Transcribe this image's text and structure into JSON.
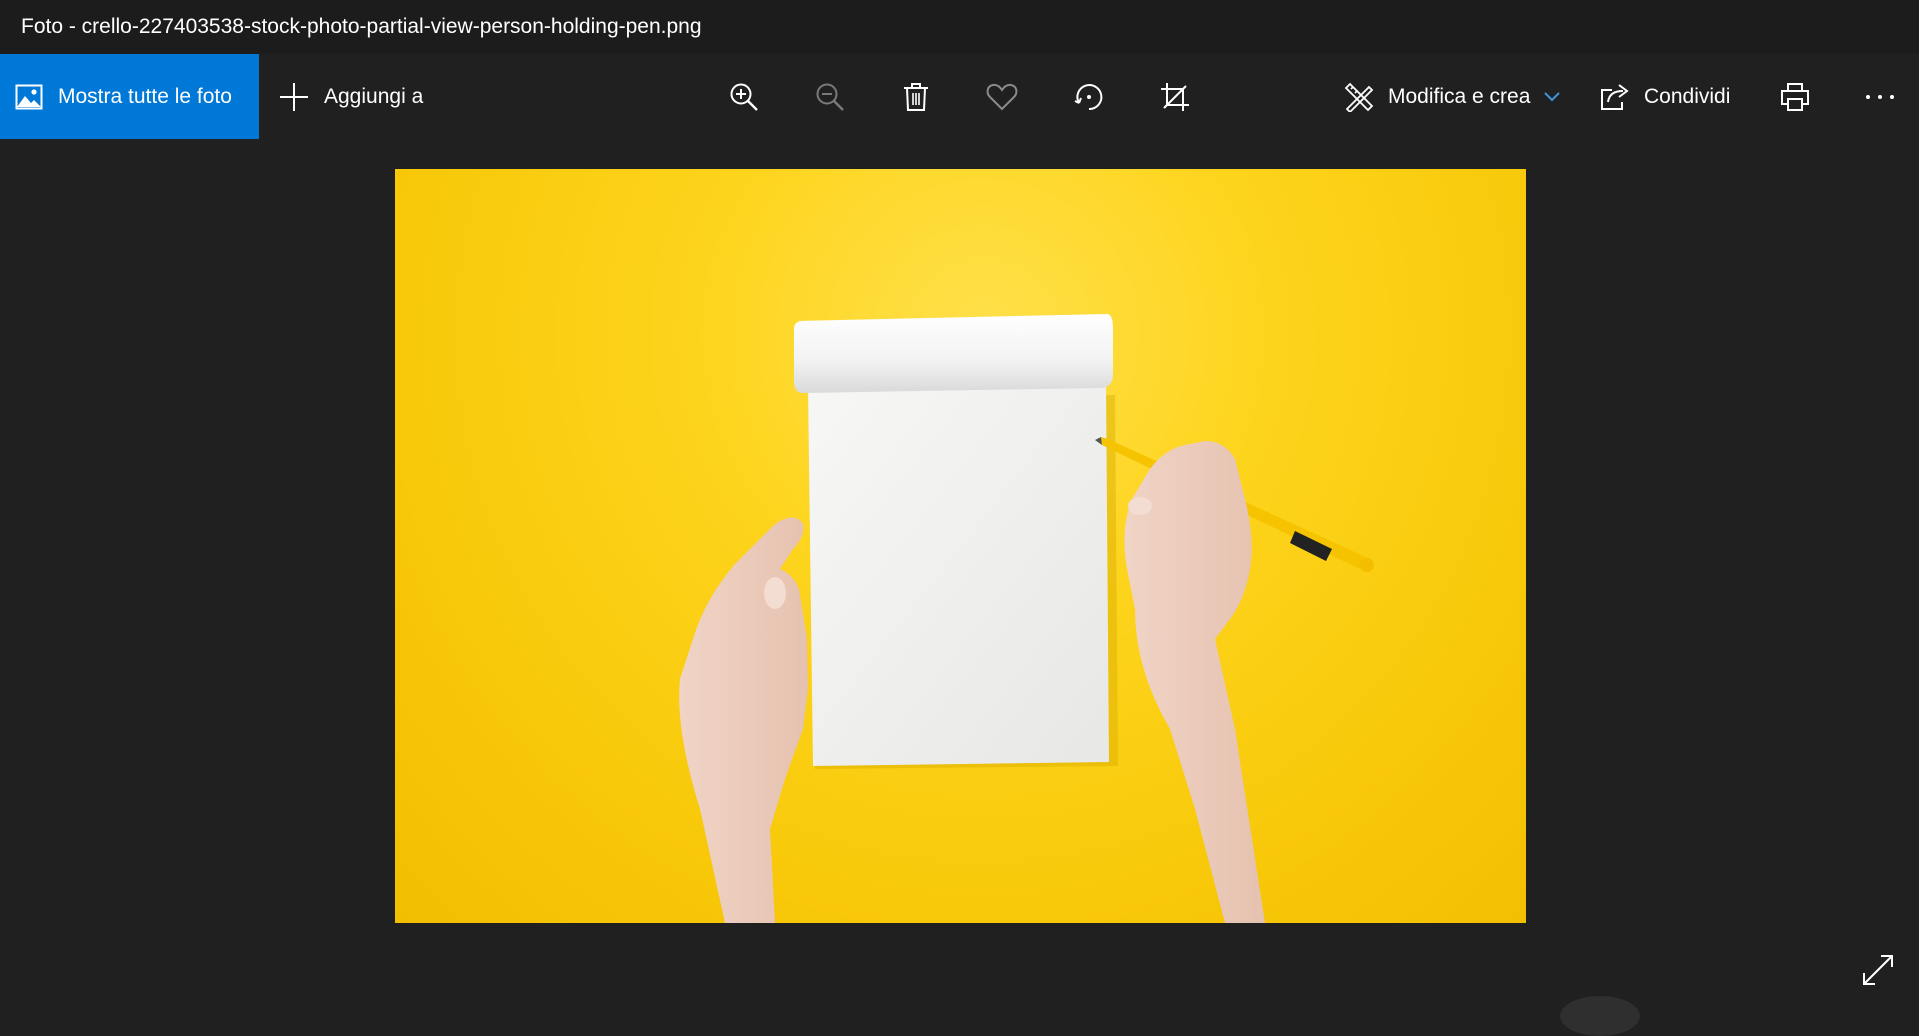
{
  "window": {
    "title": "Foto - crello-227403538-stock-photo-partial-view-person-holding-pen.png"
  },
  "toolbar": {
    "show_all_label": "Mostra tutte le foto",
    "add_label": "Aggiungi a",
    "edit_label": "Modifica e crea",
    "share_label": "Condividi",
    "accent_color": "#0078d7"
  },
  "icons": {
    "show_all": "photos-icon",
    "add": "plus-icon",
    "zoom_in": "zoom-in-icon",
    "zoom_out": "zoom-out-icon",
    "delete": "trash-icon",
    "favorite": "heart-icon",
    "rotate": "rotate-icon",
    "crop": "crop-icon",
    "edit": "edit-create-icon",
    "edit_dropdown": "chevron-down-icon",
    "share": "share-icon",
    "print": "printer-icon",
    "more": "more-icon",
    "expand": "expand-icon"
  },
  "photo": {
    "background_color": "#fdd41c"
  }
}
